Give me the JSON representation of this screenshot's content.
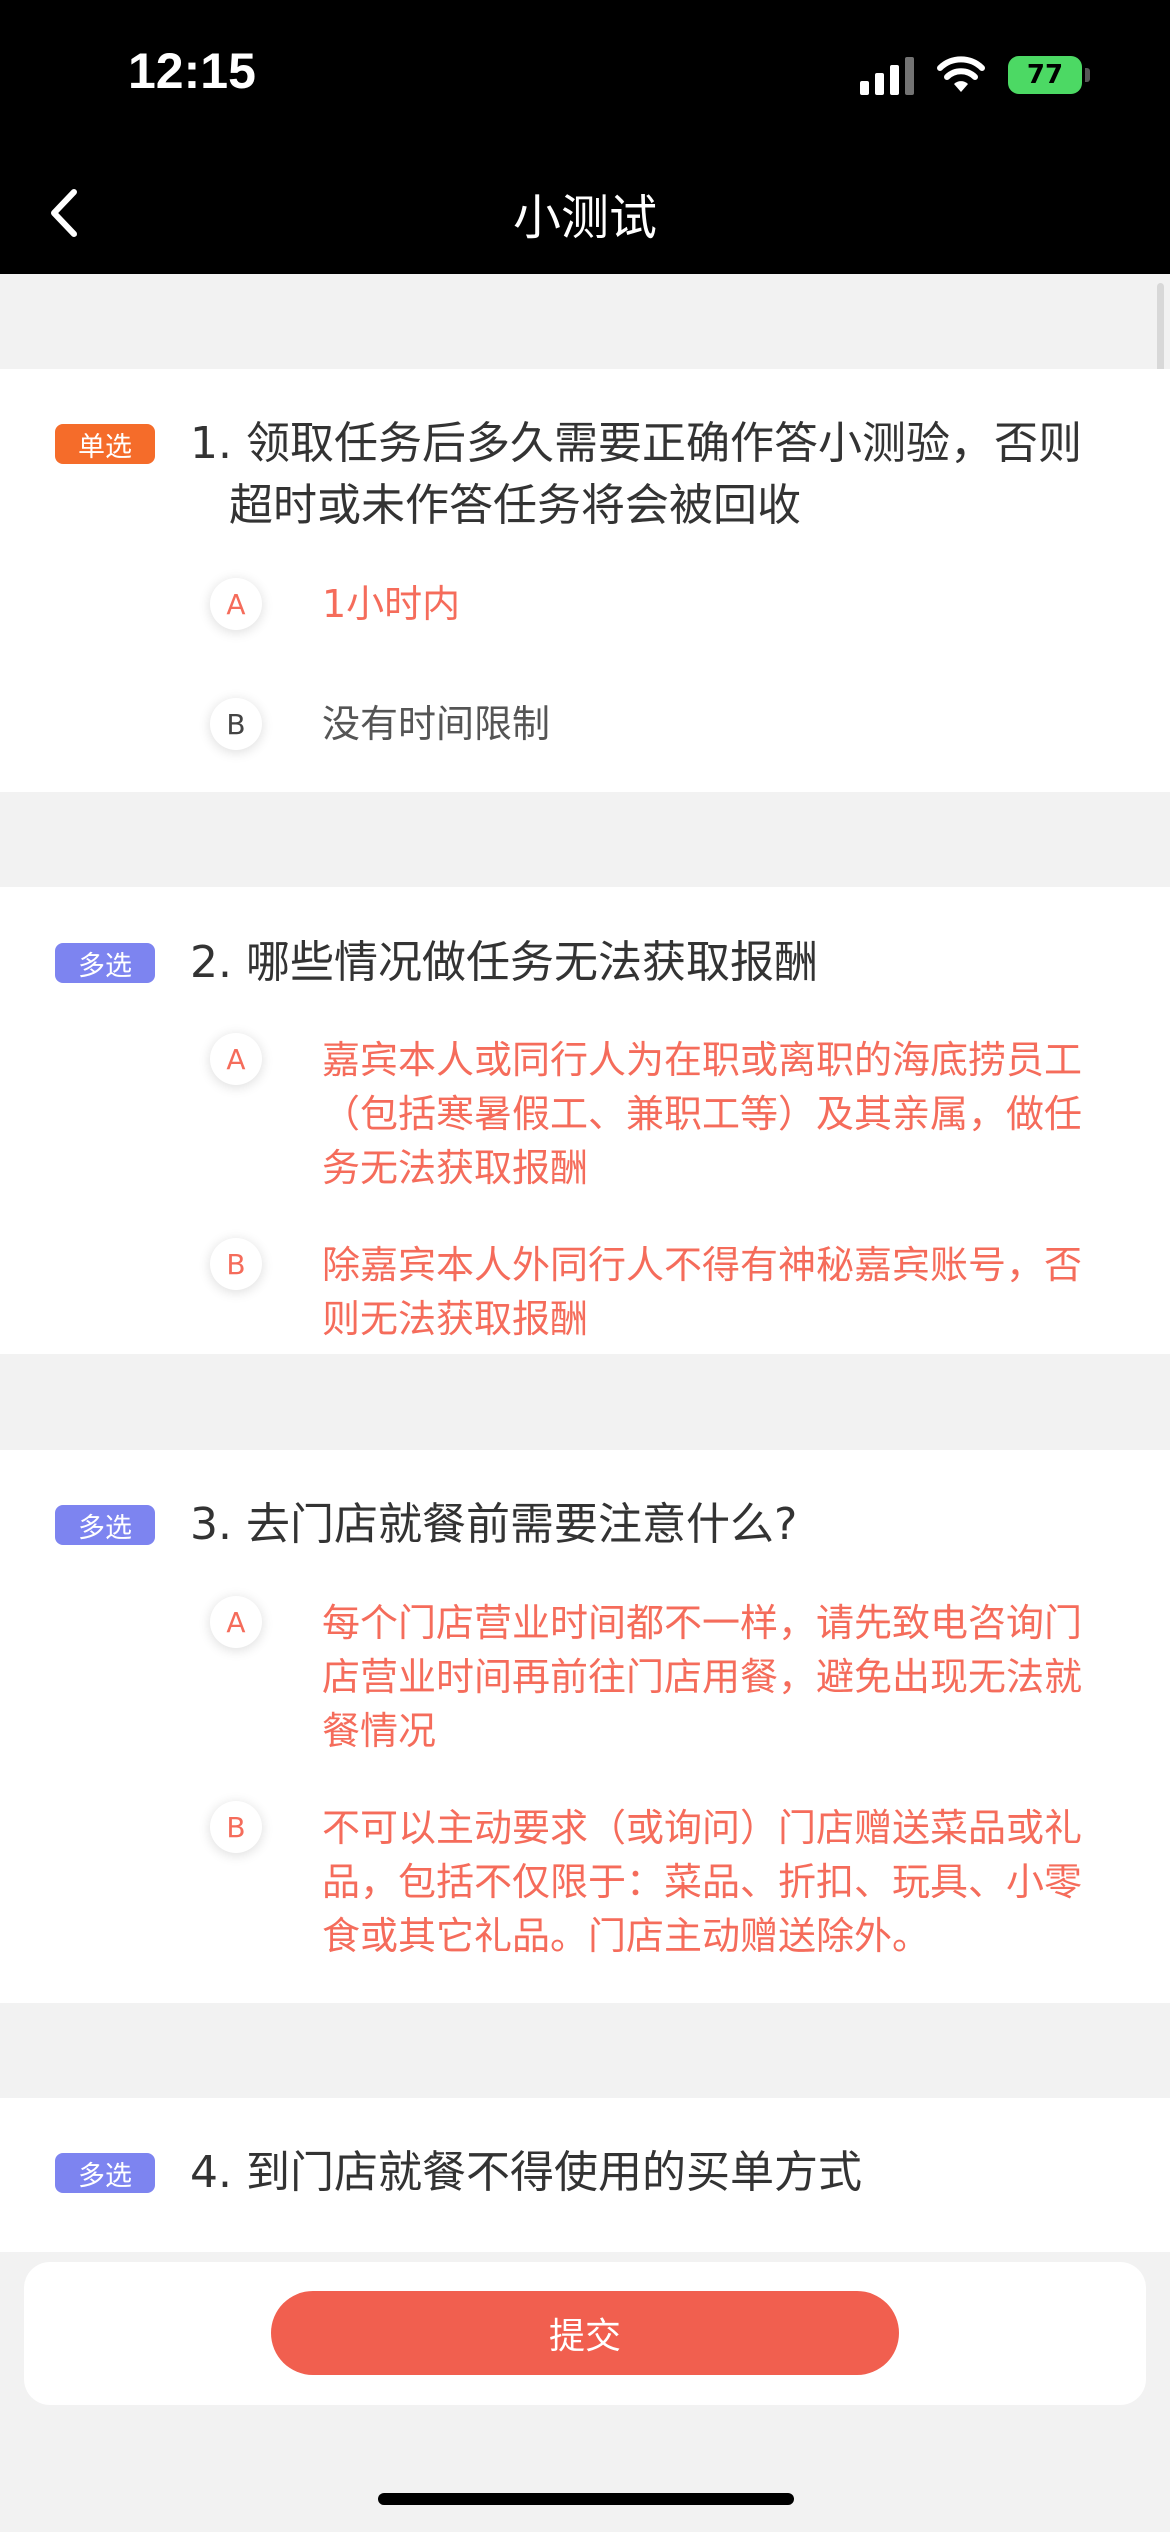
{
  "status_bar": {
    "time": "12:15",
    "battery": "77"
  },
  "nav": {
    "title": "小测试"
  },
  "questions": [
    {
      "tag": "单选",
      "text": "1. 领取任务后多久需要正确作答小测验，否则超时或未作答任务将会被回收",
      "options": [
        {
          "letter": "A",
          "text": "1小时内"
        },
        {
          "letter": "B",
          "text": "没有时间限制"
        }
      ]
    },
    {
      "tag": "多选",
      "text": "2. 哪些情况做任务无法获取报酬",
      "options": [
        {
          "letter": "A",
          "text": "嘉宾本人或同行人为在职或离职的海底捞员工（包括寒暑假工、兼职工等）及其亲属，做任务无法获取报酬"
        },
        {
          "letter": "B",
          "text": "除嘉宾本人外同行人不得有神秘嘉宾账号，否则无法获取报酬"
        }
      ]
    },
    {
      "tag": "多选",
      "text": "3. 去门店就餐前需要注意什么?",
      "options": [
        {
          "letter": "A",
          "text": "每个门店营业时间都不一样，请先致电咨询门店营业时间再前往门店用餐，避免出现无法就餐情况"
        },
        {
          "letter": "B",
          "text": "不可以主动要求（或询问）门店赠送菜品或礼品，包括不仅限于：菜品、折扣、玩具、小零食或其它礼品。门店主动赠送除外。"
        }
      ]
    },
    {
      "tag": "多选",
      "text": "4. 到门店就餐不得使用的买单方式"
    }
  ],
  "submit": {
    "label": "提交"
  },
  "colors": {
    "selected": "#f56c5b",
    "single_tag": "#f56c2a",
    "multi_tag": "#7d84f0",
    "button": "#f15f4f"
  }
}
